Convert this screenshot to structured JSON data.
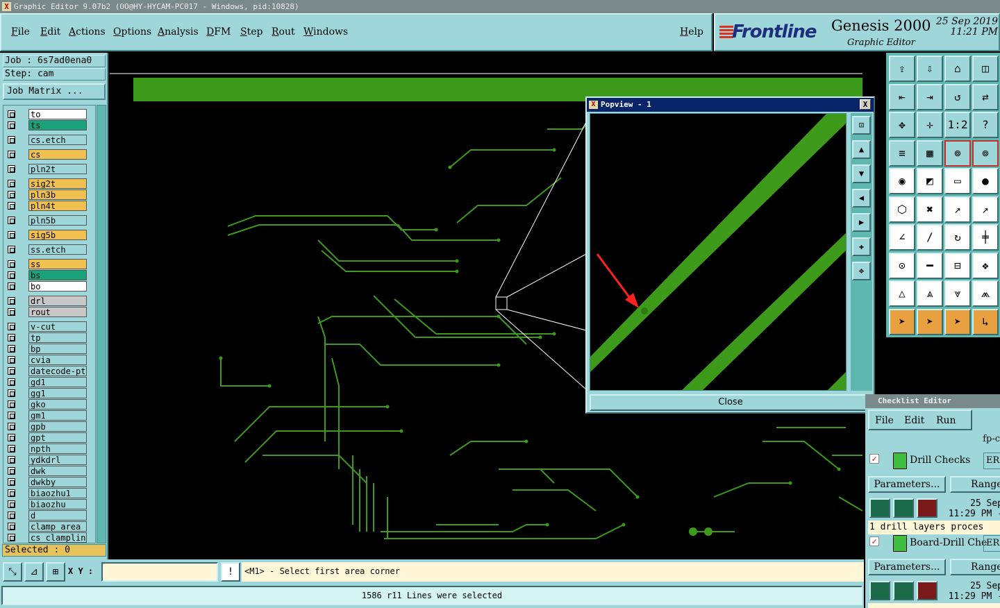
{
  "window": {
    "title": "Graphic Editor 9.07b2 (OO@HY-HYCAM-PC017 - Windows, pid:10828)"
  },
  "menu": {
    "file": "File",
    "edit": "Edit",
    "actions": "Actions",
    "options": "Options",
    "analysis": "Analysis",
    "dfm": "DFM",
    "step": "Step",
    "rout": "Rout",
    "windows": "Windows",
    "help": "Help"
  },
  "brand": {
    "logo": "Frontline",
    "product": "Genesis 2000",
    "subtitle": "Graphic Editor",
    "date": "25 Sep 2019",
    "time": "11:21 PM"
  },
  "job": {
    "job_line": "Job : 6s7ad0ena0",
    "step_line": "Step: cam",
    "matrix_button": "Job Matrix ..."
  },
  "layers": [
    {
      "name": "to",
      "color": "#ffffff"
    },
    {
      "name": "ts",
      "color": "#1aa37a"
    },
    {
      "name": "cs.etch",
      "color": "#9ed6da"
    },
    {
      "name": "cs",
      "color": "#f0c050"
    },
    {
      "name": "pln2t",
      "color": "#9ed6da"
    },
    {
      "name": "sig2t",
      "color": "#f0c050"
    },
    {
      "name": "pln3b",
      "color": "#f0c050"
    },
    {
      "name": "pln4t",
      "color": "#f0c050"
    },
    {
      "name": "pln5b",
      "color": "#9ed6da"
    },
    {
      "name": "sig5b",
      "color": "#f0c050"
    },
    {
      "name": "ss.etch",
      "color": "#9ed6da"
    },
    {
      "name": "ss",
      "color": "#f0c050"
    },
    {
      "name": "bs",
      "color": "#1aa37a"
    },
    {
      "name": "bo",
      "color": "#ffffff"
    },
    {
      "name": "drl",
      "color": "#c8c8c8"
    },
    {
      "name": "rout",
      "color": "#c8c8c8"
    },
    {
      "name": "v-cut",
      "color": "#9ed6da"
    },
    {
      "name": "tp",
      "color": "#9ed6da"
    },
    {
      "name": "bp",
      "color": "#9ed6da"
    },
    {
      "name": "cvia",
      "color": "#9ed6da"
    },
    {
      "name": "datecode-pte",
      "color": "#9ed6da"
    },
    {
      "name": "gd1",
      "color": "#9ed6da"
    },
    {
      "name": "gg1",
      "color": "#9ed6da"
    },
    {
      "name": "gko",
      "color": "#9ed6da"
    },
    {
      "name": "gm1",
      "color": "#9ed6da"
    },
    {
      "name": "gpb",
      "color": "#9ed6da"
    },
    {
      "name": "gpt",
      "color": "#9ed6da"
    },
    {
      "name": "npth",
      "color": "#9ed6da"
    },
    {
      "name": "ydkdrl",
      "color": "#9ed6da"
    },
    {
      "name": "dwk",
      "color": "#9ed6da"
    },
    {
      "name": "dwkby",
      "color": "#9ed6da"
    },
    {
      "name": "biaozhu1",
      "color": "#9ed6da"
    },
    {
      "name": "biaozhu",
      "color": "#9ed6da"
    },
    {
      "name": "d",
      "color": "#9ed6da"
    },
    {
      "name": "clamp_area",
      "color": "#9ed6da"
    },
    {
      "name": "cs_clampline",
      "color": "#9ed6da"
    }
  ],
  "selected_label": "Selected : 0",
  "popview": {
    "title": "Popview - 1",
    "close_label": "Close",
    "close_x": "X"
  },
  "checklist": {
    "title": "Checklist Editor",
    "menu": {
      "file": "File",
      "edit": "Edit",
      "run": "Run"
    },
    "fp_label": "fp-c",
    "rows": [
      {
        "name": "Drill Checks",
        "erb": "ERB",
        "params": "Parameters...",
        "ranges": "Ranges",
        "date": "25 Sep",
        "time": "11:29 PM -",
        "message": "1 drill layers proces"
      },
      {
        "name": "Board-Drill Che",
        "erb": "ERB",
        "params": "Parameters...",
        "ranges": "Ranges",
        "date": "25 Sep",
        "time": "11:29 PM -",
        "message": ""
      }
    ]
  },
  "bottom": {
    "xy_label": "X Y :",
    "xy_value": "",
    "prompt": "<M1> - Select first area corner",
    "status": "1586 r11 Lines were selected"
  },
  "colors": {
    "panel": "#9ed6da",
    "trace": "#3d9a1a",
    "accent_red": "#ff2020"
  }
}
